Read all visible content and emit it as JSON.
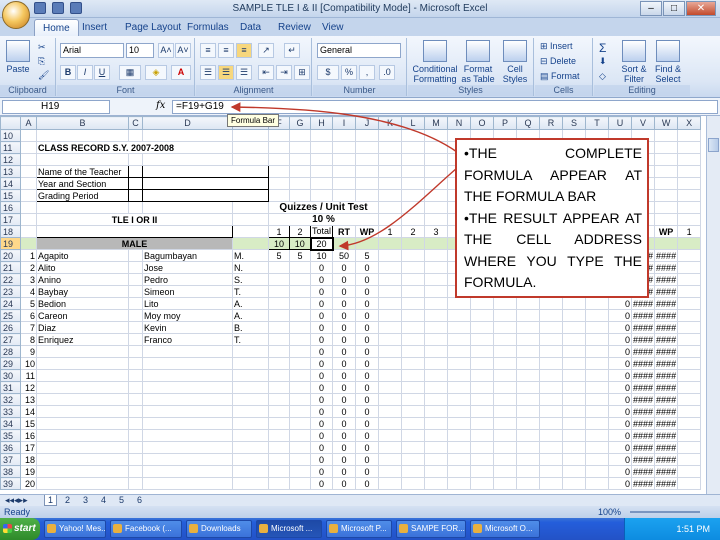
{
  "window": {
    "title": "SAMPLE TLE I & II  [Compatibility Mode] - Microsoft Excel",
    "controls": [
      "–",
      "□",
      "✕"
    ]
  },
  "ribbon": {
    "tabs": [
      "Home",
      "Insert",
      "Page Layout",
      "Formulas",
      "Data",
      "Review",
      "View"
    ],
    "active_tab": "Home",
    "groups": {
      "clipboard": {
        "label": "Clipboard",
        "paste": "Paste"
      },
      "font": {
        "label": "Font",
        "font_name": "Arial",
        "font_size": "10",
        "grow": "A˄",
        "shrink": "A˅",
        "bold": "B",
        "italic": "I",
        "underline": "U",
        "text_color": "A"
      },
      "alignment": {
        "label": "Alignment"
      },
      "number": {
        "label": "Number",
        "format": "General",
        "currency": "$",
        "percent": "%",
        "comma": ","
      },
      "styles": {
        "label": "Styles",
        "conditional": "Conditional\nFormatting",
        "format_table": "Format\nas Table",
        "cell_styles": "Cell\nStyles"
      },
      "cells": {
        "label": "Cells",
        "insert": "Insert",
        "delete": "Delete",
        "format": "Format"
      },
      "editing": {
        "label": "Editing",
        "sum": "Σ",
        "sort": "Sort &\nFilter",
        "find": "Find &\nSelect"
      }
    }
  },
  "formula_bar": {
    "name_box": "H19",
    "fx": "fx",
    "formula": "=F19+G19",
    "tooltip": "Formula Bar"
  },
  "columns": [
    "",
    "A",
    "B",
    "C",
    "D",
    "E",
    "F",
    "G",
    "H",
    "I",
    "J",
    "K",
    "L",
    "M",
    "N",
    "O",
    "P",
    "Q",
    "R",
    "S",
    "T",
    "U",
    "V",
    "W",
    "X"
  ],
  "sheet": {
    "class_record": "CLASS RECORD S.Y. 2007-2008",
    "teacher_label": "Name    of the Teacher",
    "year_label": "Year and Section",
    "grading_label": "Grading Period",
    "subject": "TLE I OR II",
    "quizzes_header": "Quizzes / Unit Test",
    "quizzes_pct": "10 %",
    "q1": "1",
    "q2": "2",
    "total": "Total",
    "rt": "RT",
    "wp": "WP",
    "k_head": "1",
    "l_head": "2",
    "m_head": "3",
    "u_rt": "RT",
    "u_wp": "WP",
    "x_head": "1",
    "male": "MALE",
    "max_f": "10",
    "max_g": "10",
    "max_h": "20",
    "hash": "####",
    "zero": "0",
    "students": [
      {
        "no": "1",
        "first": "Agapito",
        "last": "Bagumbayan",
        "mi": "M.",
        "f": "5",
        "g": "5",
        "h": "10",
        "i": "50",
        "j": "5"
      },
      {
        "no": "2",
        "first": "Alito",
        "last": "Jose",
        "mi": "N.",
        "f": "",
        "g": "",
        "h": "0",
        "i": "0",
        "j": "0"
      },
      {
        "no": "3",
        "first": "Anino",
        "last": "Pedro",
        "mi": "S.",
        "f": "",
        "g": "",
        "h": "0",
        "i": "0",
        "j": "0"
      },
      {
        "no": "4",
        "first": "Baybay",
        "last": "Simeon",
        "mi": "T.",
        "f": "",
        "g": "",
        "h": "0",
        "i": "0",
        "j": "0"
      },
      {
        "no": "5",
        "first": "Bedion",
        "last": "Lito",
        "mi": "A.",
        "f": "",
        "g": "",
        "h": "0",
        "i": "0",
        "j": "0"
      },
      {
        "no": "6",
        "first": "Careon",
        "last": "Moy moy",
        "mi": "A.",
        "f": "",
        "g": "",
        "h": "0",
        "i": "0",
        "j": "0"
      },
      {
        "no": "7",
        "first": "Diaz",
        "last": "Kevin",
        "mi": "B.",
        "f": "",
        "g": "",
        "h": "0",
        "i": "0",
        "j": "0"
      },
      {
        "no": "8",
        "first": "Enriquez",
        "last": "Franco",
        "mi": "T.",
        "f": "",
        "g": "",
        "h": "0",
        "i": "0",
        "j": "0"
      },
      {
        "no": "9",
        "first": "",
        "last": "",
        "mi": "",
        "f": "",
        "g": "",
        "h": "0",
        "i": "0",
        "j": "0"
      },
      {
        "no": "10",
        "first": "",
        "last": "",
        "mi": "",
        "f": "",
        "g": "",
        "h": "0",
        "i": "0",
        "j": "0"
      },
      {
        "no": "11",
        "first": "",
        "last": "",
        "mi": "",
        "f": "",
        "g": "",
        "h": "0",
        "i": "0",
        "j": "0"
      },
      {
        "no": "12",
        "first": "",
        "last": "",
        "mi": "",
        "f": "",
        "g": "",
        "h": "0",
        "i": "0",
        "j": "0"
      },
      {
        "no": "13",
        "first": "",
        "last": "",
        "mi": "",
        "f": "",
        "g": "",
        "h": "0",
        "i": "0",
        "j": "0"
      },
      {
        "no": "14",
        "first": "",
        "last": "",
        "mi": "",
        "f": "",
        "g": "",
        "h": "0",
        "i": "0",
        "j": "0"
      },
      {
        "no": "15",
        "first": "",
        "last": "",
        "mi": "",
        "f": "",
        "g": "",
        "h": "0",
        "i": "0",
        "j": "0"
      },
      {
        "no": "16",
        "first": "",
        "last": "",
        "mi": "",
        "f": "",
        "g": "",
        "h": "0",
        "i": "0",
        "j": "0"
      },
      {
        "no": "17",
        "first": "",
        "last": "",
        "mi": "",
        "f": "",
        "g": "",
        "h": "0",
        "i": "0",
        "j": "0"
      },
      {
        "no": "18",
        "first": "",
        "last": "",
        "mi": "",
        "f": "",
        "g": "",
        "h": "0",
        "i": "0",
        "j": "0"
      },
      {
        "no": "19",
        "first": "",
        "last": "",
        "mi": "",
        "f": "",
        "g": "",
        "h": "0",
        "i": "0",
        "j": "0"
      },
      {
        "no": "20",
        "first": "",
        "last": "",
        "mi": "",
        "f": "",
        "g": "",
        "h": "0",
        "i": "0",
        "j": "0"
      }
    ]
  },
  "callout": {
    "line1": "•THE COMPLETE FORMULA APPEAR AT THE FORMULA BAR",
    "line2": "•THE RESULT APPEAR AT THE CELL ADDRESS WHERE YOU TYPE THE FORMULA."
  },
  "sheet_tabs": [
    "1",
    "2",
    "3",
    "4",
    "5",
    "6"
  ],
  "status": "Ready",
  "zoom": "100%",
  "taskbar": {
    "start": "start",
    "items": [
      "Yahoo! Mes...",
      "Facebook (...",
      "Downloads",
      "Microsoft ...",
      "Microsoft P...",
      "SAMPE FOR...",
      "Microsoft O..."
    ],
    "clock": "1:51 PM"
  },
  "colors": {
    "callout_border": "#c0392b",
    "selected_cell": "#ffd88a",
    "header_fill": "#d8ecc5"
  }
}
